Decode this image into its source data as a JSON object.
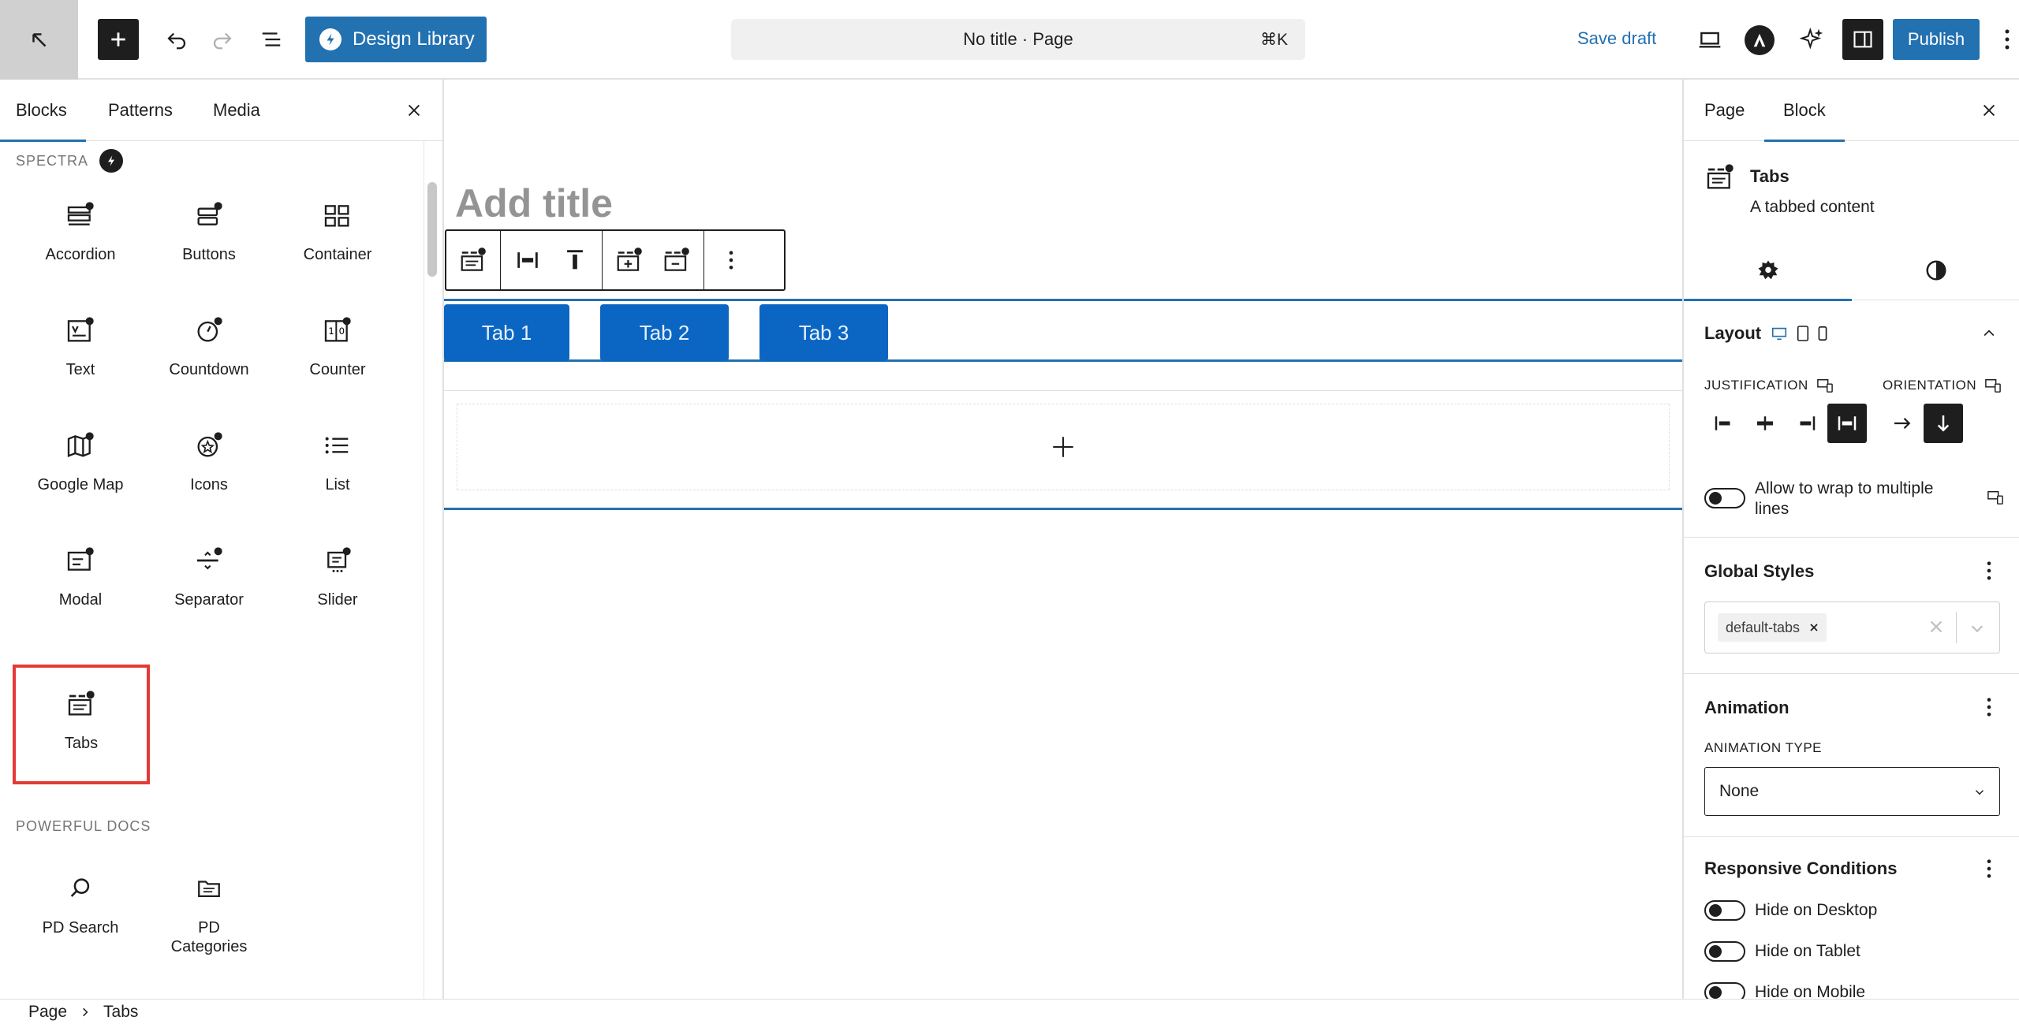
{
  "topbar": {
    "design_library_label": "Design Library",
    "document_title": "No title · Page",
    "command_shortcut": "⌘K",
    "save_draft_label": "Save draft",
    "publish_label": "Publish",
    "accent_color": "#2271b1"
  },
  "inserter": {
    "tabs": [
      {
        "label": "Blocks"
      },
      {
        "label": "Patterns"
      },
      {
        "label": "Media"
      }
    ],
    "categories": [
      {
        "title": "SPECTRA",
        "blocks": [
          {
            "label": "Accordion",
            "icon": "accordion-icon"
          },
          {
            "label": "Buttons",
            "icon": "buttons-icon"
          },
          {
            "label": "Container",
            "icon": "container-icon"
          },
          {
            "label": "Text",
            "icon": "text-icon"
          },
          {
            "label": "Countdown",
            "icon": "countdown-icon"
          },
          {
            "label": "Counter",
            "icon": "counter-icon"
          },
          {
            "label": "Google Map",
            "icon": "google-map-icon"
          },
          {
            "label": "Icons",
            "icon": "icons-icon"
          },
          {
            "label": "List",
            "icon": "list-icon"
          },
          {
            "label": "Modal",
            "icon": "modal-icon"
          },
          {
            "label": "Separator",
            "icon": "separator-icon"
          },
          {
            "label": "Slider",
            "icon": "slider-icon"
          },
          {
            "label": "Tabs",
            "icon": "tabs-icon"
          }
        ]
      },
      {
        "title": "POWERFUL DOCS",
        "blocks": [
          {
            "label": "PD Search",
            "icon": "search-icon"
          },
          {
            "label": "PD Categories",
            "icon": "categories-icon"
          }
        ]
      }
    ],
    "highlight_color": "#e53935"
  },
  "canvas": {
    "title_placeholder": "Add title",
    "tabs": [
      {
        "label": "Tab 1"
      },
      {
        "label": "Tab 2"
      },
      {
        "label": "Tab 3"
      }
    ],
    "tab_color": "#0a66c2"
  },
  "sidebar": {
    "tabs": [
      {
        "label": "Page"
      },
      {
        "label": "Block"
      }
    ],
    "block_name": "Tabs",
    "block_description": "A tabbed content",
    "layout": {
      "title": "Layout",
      "justification_label": "JUSTIFICATION",
      "orientation_label": "ORIENTATION",
      "wrap_label": "Allow to wrap to multiple lines"
    },
    "global_styles": {
      "title": "Global Styles",
      "selected_chip": "default-tabs"
    },
    "animation": {
      "title": "Animation",
      "type_label": "ANIMATION TYPE",
      "selected": "None"
    },
    "responsive": {
      "title": "Responsive Conditions",
      "toggles": [
        {
          "label": "Hide on Desktop"
        },
        {
          "label": "Hide on Tablet"
        },
        {
          "label": "Hide on Mobile"
        }
      ]
    }
  },
  "breadcrumb": {
    "items": [
      "Page",
      "Tabs"
    ]
  }
}
